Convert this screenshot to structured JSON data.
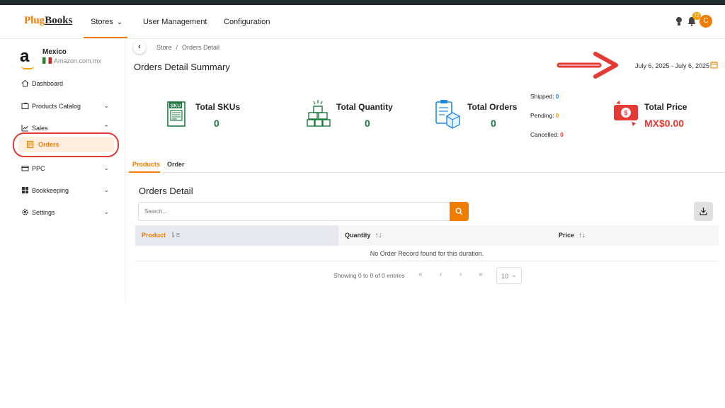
{
  "brand": {
    "logo_part1": "Plug",
    "logo_part2": "Books"
  },
  "topnav": {
    "stores_label": "Stores",
    "user_management_label": "User Management",
    "configuration_label": "Configuration",
    "notification_count": "72",
    "avatar_initial": "C"
  },
  "store": {
    "logo_letter": "a",
    "name": "Mexico",
    "domain": "Amazon.com.mx"
  },
  "sidebar": {
    "items": [
      {
        "label": "Dashboard"
      },
      {
        "label": "Products Catalog"
      },
      {
        "label": "Sales"
      },
      {
        "label": "Orders"
      },
      {
        "label": "PPC"
      },
      {
        "label": "Bookkeeping"
      },
      {
        "label": "Settings"
      }
    ]
  },
  "breadcrumb": {
    "parent": "Store",
    "separator": "/",
    "current": "Orders Detail"
  },
  "page": {
    "title": "Orders Detail Summary",
    "date_range": "July 6, 2025 - July 6, 2025"
  },
  "stats": {
    "skus": {
      "icon_text": "SKU",
      "title": "Total SKUs",
      "value": "0"
    },
    "quantity": {
      "title": "Total Quantity",
      "value": "0"
    },
    "orders": {
      "title": "Total Orders",
      "value": "0"
    },
    "price": {
      "title": "Total Price",
      "value": "MX$0.00"
    }
  },
  "order_status": {
    "shipped_label": "Shipped:",
    "shipped_value": "0",
    "pending_label": "Pending:",
    "pending_value": "0",
    "cancelled_label": "Cancelled:",
    "cancelled_value": "0"
  },
  "tabs": {
    "products": "Products",
    "order": "Order"
  },
  "detail": {
    "title": "Orders Detail",
    "search_placeholder": "Search...",
    "columns": {
      "product": "Product",
      "quantity": "Quantity",
      "price": "Price"
    },
    "empty_message": "No Order Record found for this duration."
  },
  "pagination": {
    "info": "Showing 0 to 0 of 0 entries",
    "first": "«",
    "prev": "‹",
    "next": "›",
    "last": "»",
    "per_page": "10"
  },
  "colors": {
    "accent": "#f07c00",
    "success": "#1b7a3f",
    "danger": "#e53935",
    "info": "#1e88e5",
    "warning": "#f0a000"
  }
}
